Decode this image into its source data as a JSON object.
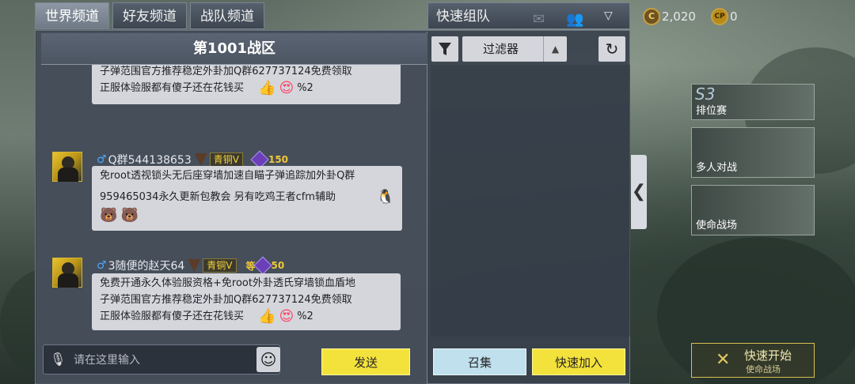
{
  "tabs": [
    {
      "label": "世界频道",
      "active": true
    },
    {
      "label": "好友频道",
      "active": false
    },
    {
      "label": "战队频道",
      "active": false
    }
  ],
  "zone_title": "第1001战区",
  "messages": [
    {
      "partial": true,
      "lines": [
        "子弹范围官方推荐稳定外卦加Q群627737124免费领取",
        "正服体验服都有傻子还在花钱买"
      ],
      "suffix": "%2"
    },
    {
      "name": "Q群544138653",
      "rank": "青铜Ⅴ",
      "level": "150",
      "lines": [
        "免root透视锁头无后座穿墙加速自瞄子弹追踪加外卦Q群",
        "959465034永久更新包教会 另有吃鸡王者cfm辅助"
      ]
    },
    {
      "name": "3随便的赵天64",
      "rank": "青铜Ⅴ",
      "level_prefix": "等",
      "level": "50",
      "lines": [
        "免费开通永久体验服资格+免root外卦透氏穿墙锁血盾地",
        "子弹范围官方推荐稳定外卦加Q群627737124免费领取",
        "正服体验服都有傻子还在花钱买"
      ],
      "suffix": "%2"
    }
  ],
  "input": {
    "placeholder": "请在这里输入"
  },
  "buttons": {
    "send": "发送",
    "gather": "召集",
    "quick_join": "快速加入"
  },
  "right_panel": {
    "title": "快速组队",
    "filter_label": "过滤器"
  },
  "currency": {
    "cp_value": "2,020",
    "bp_value": "0",
    "cp_symbol": "C",
    "bp_symbol": "CP"
  },
  "modes": [
    {
      "season": "S3",
      "label": "排位赛"
    },
    {
      "label": "多人对战"
    },
    {
      "label": "使命战场"
    }
  ],
  "quick_start": {
    "title": "快速开始",
    "subtitle": "使命战场"
  },
  "colors": {
    "accent_yellow": "#f4e23c",
    "accent_cyan": "#bfe0ec",
    "panel": "#3a424e"
  }
}
